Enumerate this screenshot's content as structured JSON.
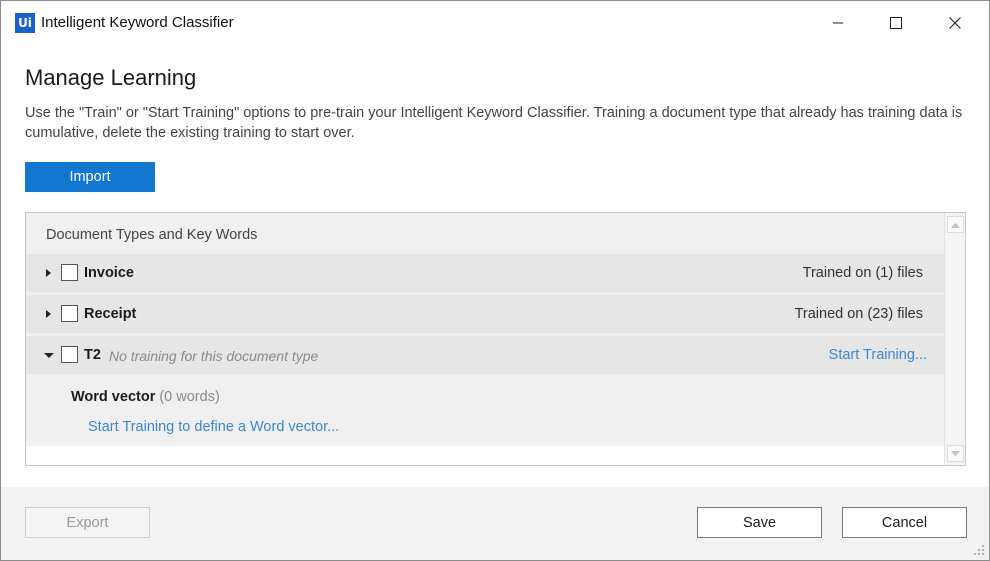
{
  "window": {
    "app_icon_text": "Ui",
    "title": "Intelligent Keyword Classifier"
  },
  "page": {
    "heading": "Manage Learning",
    "description": "Use the \"Train\" or \"Start Training\" options to pre-train your Intelligent Keyword Classifier. Training a document type that already has training data is cumulative, delete the existing training to start over.",
    "import_label": "Import"
  },
  "panel": {
    "header": "Document Types and Key Words",
    "rows": [
      {
        "name": "Invoice",
        "status": "Trained on (1) files",
        "expanded": false,
        "checked": false
      },
      {
        "name": "Receipt",
        "status": "Trained on (23) files",
        "expanded": false,
        "checked": false
      },
      {
        "name": "T2",
        "note": "No training for this document type",
        "action": "Start Training...",
        "expanded": true,
        "checked": false
      }
    ],
    "word_vector": {
      "label": "Word vector",
      "count": "(0 words)",
      "link": "Start Training to define a Word vector..."
    }
  },
  "footer": {
    "export_label": "Export",
    "save_label": "Save",
    "cancel_label": "Cancel"
  },
  "colors": {
    "accent": "#1277cf",
    "link": "#3a87d1",
    "app_icon": "#1a62c9"
  }
}
